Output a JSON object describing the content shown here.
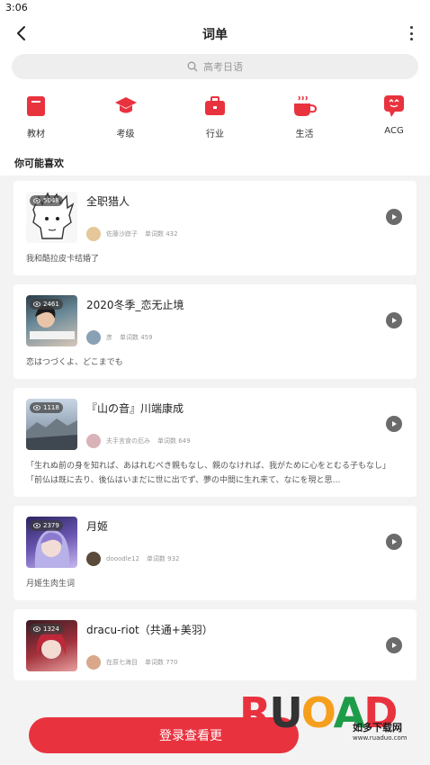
{
  "status": {
    "time": "3:06"
  },
  "header": {
    "title": "词单"
  },
  "search": {
    "placeholder": "高考日语"
  },
  "categories": [
    {
      "label": "教材",
      "icon": "textbook-icon"
    },
    {
      "label": "考级",
      "icon": "graduation-cap-icon"
    },
    {
      "label": "行业",
      "icon": "briefcase-icon"
    },
    {
      "label": "生活",
      "icon": "coffee-cup-icon"
    },
    {
      "label": "ACG",
      "icon": "chat-face-icon"
    }
  ],
  "section_title": "你可能喜欢",
  "cards": [
    {
      "views": "5048",
      "name": "全职猎人",
      "author": "佐藤沙踪子",
      "count": "单词数 432",
      "desc": "我和酷拉皮卡结婚了",
      "desc2": ""
    },
    {
      "views": "2461",
      "name": "2020冬季_恋无止境",
      "author": "彦",
      "count": "单词数 459",
      "desc": "恋はつづくよ、どこまでも",
      "desc2": ""
    },
    {
      "views": "1118",
      "name": "『山の音』川端康成",
      "author": "夫手言食の厄み",
      "count": "单词数 649",
      "desc": "「生れぬ前の身を知れば、あはれむべき親もなし、親のなければ、我がために心をとむる子もなし」",
      "desc2": "「前仏は既に去り、後仏はいまだに世に出でず、夢の中間に生れ来て、なにを現と思…"
    },
    {
      "views": "2379",
      "name": "月姬",
      "author": "dooodle12",
      "count": "单词数 932",
      "desc": "月姬生肉生词",
      "desc2": ""
    },
    {
      "views": "1324",
      "name": "dracu-riot（共通+美羽）",
      "author": "在原七海目",
      "count": "单词数 770",
      "desc": "",
      "desc2": ""
    }
  ],
  "login_button": "登录查看更",
  "watermark": {
    "logo": "RUANDAO",
    "site_name": "如多下载网",
    "url": "www.ruaduo.com"
  },
  "colors": {
    "accent": "#e8333f",
    "play": "#6b6b6b"
  }
}
